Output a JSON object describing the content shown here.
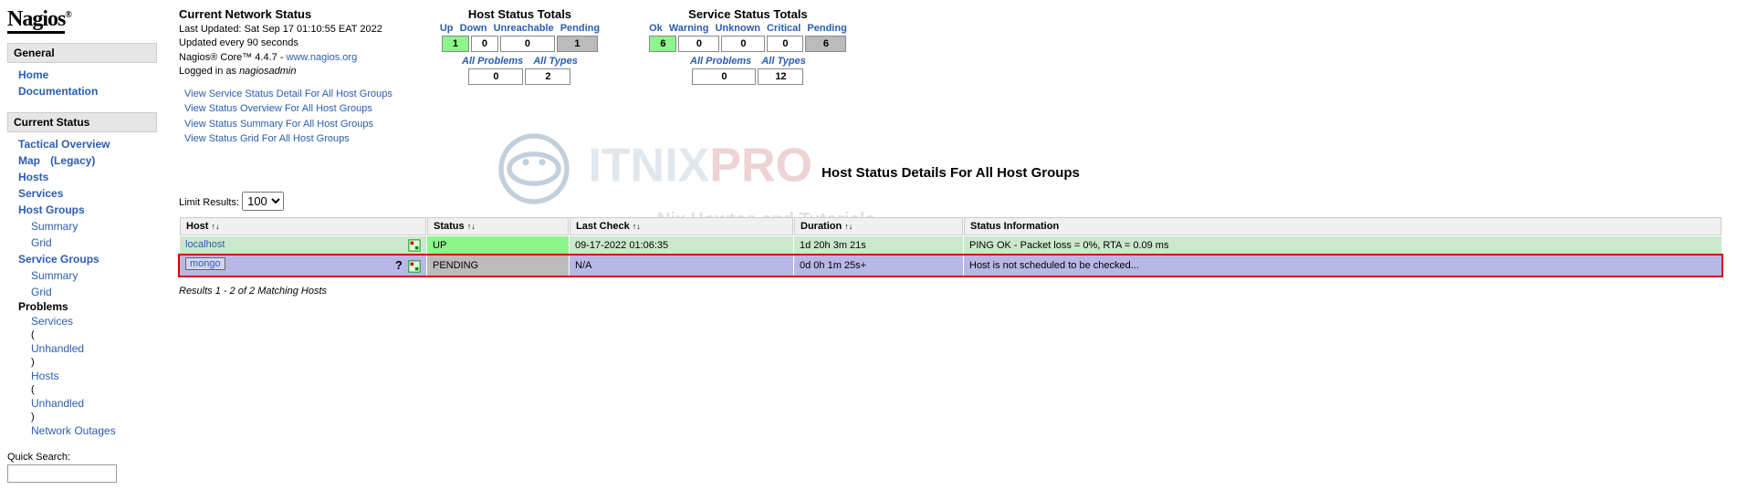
{
  "logo": {
    "text": "Nagios",
    "reg": "®"
  },
  "sidebar": {
    "general": {
      "title": "General",
      "home": "Home",
      "documentation": "Documentation"
    },
    "current_status": {
      "title": "Current Status",
      "tactical": "Tactical Overview",
      "map": "Map",
      "legacy": "(Legacy)",
      "hosts": "Hosts",
      "services": "Services",
      "host_groups": "Host Groups",
      "summary": "Summary",
      "grid": "Grid",
      "service_groups": "Service Groups",
      "problems": "Problems",
      "services_link": "Services",
      "unhandled": "Unhandled",
      "hosts_link": "Hosts",
      "network_outages": "Network Outages"
    },
    "quick_search": "Quick Search:"
  },
  "status_info": {
    "title": "Current Network Status",
    "last_updated": "Last Updated: Sat Sep 17 01:10:55 EAT 2022",
    "update_every": "Updated every 90 seconds",
    "core_version": "Nagios® Core™ 4.4.7 - ",
    "core_link": "www.nagios.org",
    "logged_in": "Logged in as ",
    "user": "nagiosadmin",
    "view_links": [
      "View Service Status Detail For All Host Groups",
      "View Status Overview For All Host Groups",
      "View Status Summary For All Host Groups",
      "View Status Grid For All Host Groups"
    ]
  },
  "host_totals": {
    "title": "Host Status Totals",
    "headers": [
      "Up",
      "Down",
      "Unreachable",
      "Pending"
    ],
    "values": [
      "1",
      "0",
      "0",
      "1"
    ],
    "sub_headers": [
      "All Problems",
      "All Types"
    ],
    "sub_values": [
      "0",
      "2"
    ]
  },
  "service_totals": {
    "title": "Service Status Totals",
    "headers": [
      "Ok",
      "Warning",
      "Unknown",
      "Critical",
      "Pending"
    ],
    "values": [
      "6",
      "0",
      "0",
      "0",
      "6"
    ],
    "sub_headers": [
      "All Problems",
      "All Types"
    ],
    "sub_values": [
      "0",
      "12"
    ]
  },
  "section_title": "Host Status Details For All Host Groups",
  "limit": {
    "label": "Limit Results:",
    "selected": "100"
  },
  "table": {
    "cols": [
      "Host",
      "Status",
      "Last Check",
      "Duration",
      "Status Information"
    ],
    "rows": [
      {
        "host": "localhost",
        "status": "UP",
        "last_check": "09-17-2022 01:06:35",
        "duration": "1d 20h 3m 21s",
        "info": "PING OK - Packet loss = 0%, RTA = 0.09 ms",
        "state": "up"
      },
      {
        "host": "mongo",
        "status": "PENDING",
        "last_check": "N/A",
        "duration": "0d 0h 1m 25s+",
        "info": "Host is not scheduled to be checked...",
        "state": "pending"
      }
    ]
  },
  "results_text": "Results 1 - 2 of 2 Matching Hosts"
}
